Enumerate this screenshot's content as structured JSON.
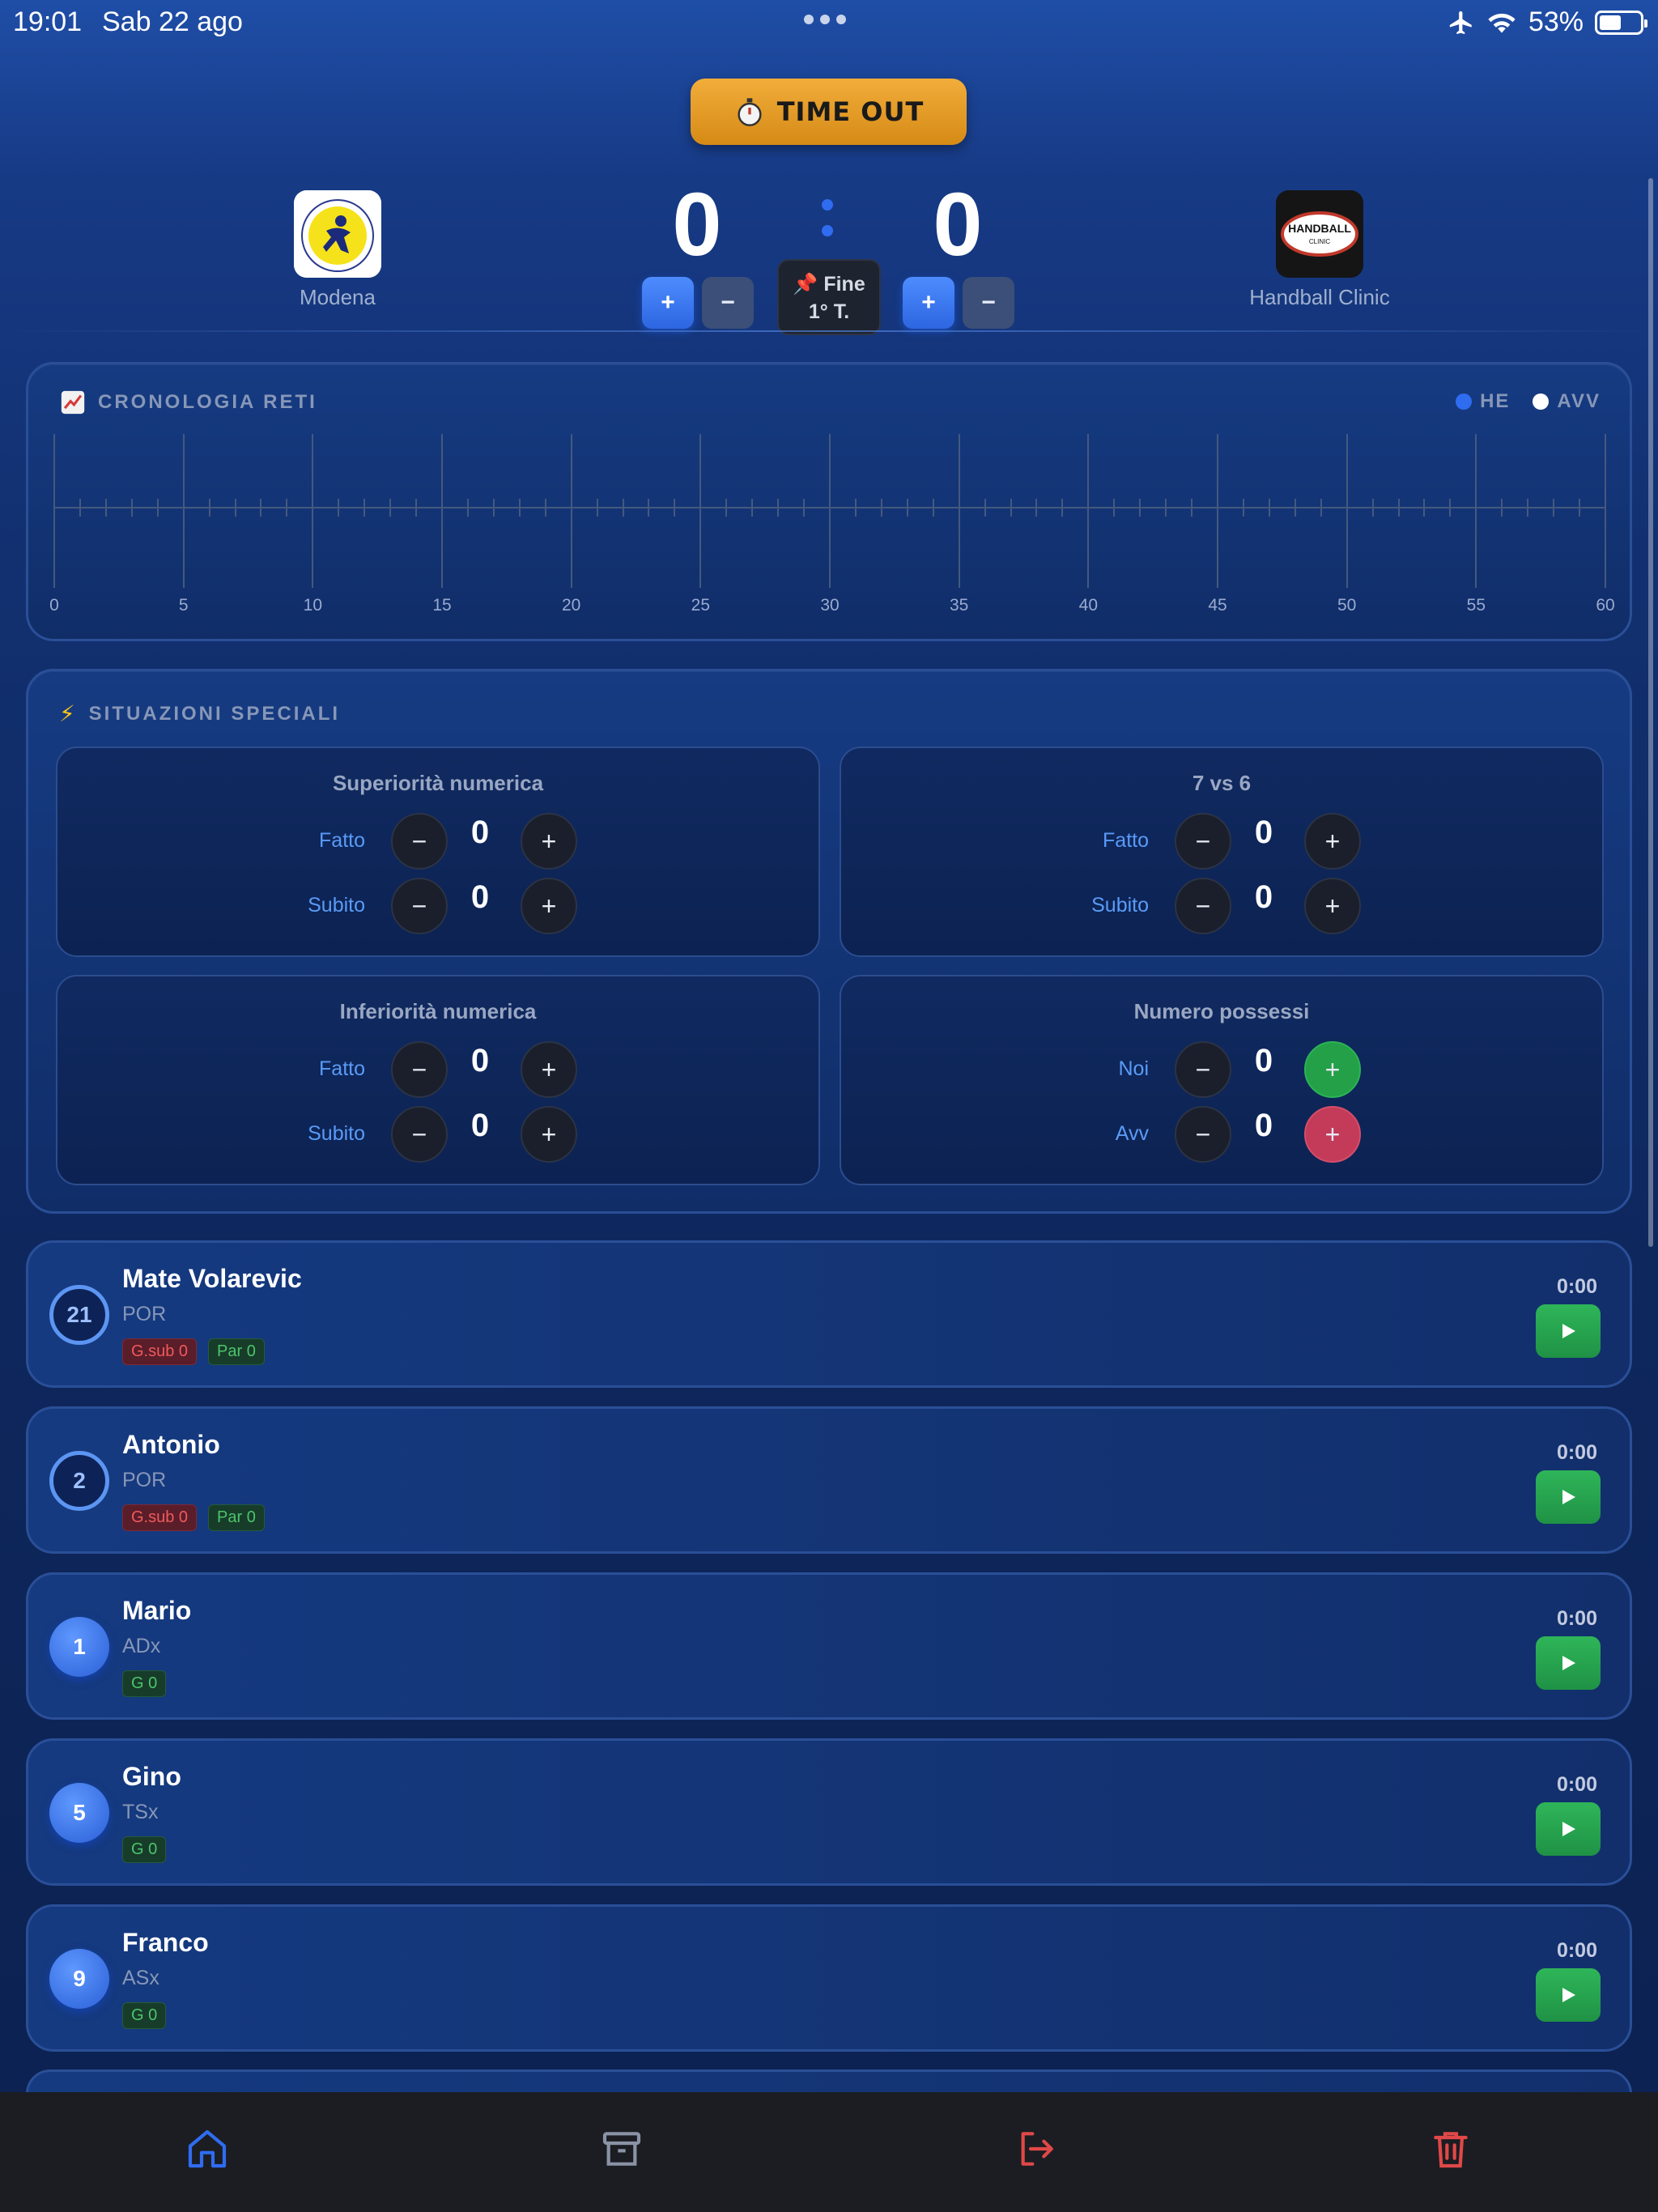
{
  "status_bar": {
    "time": "19:01",
    "date": "Sab 22 ago",
    "battery": "53%"
  },
  "timeout": {
    "icon": "stopwatch-icon",
    "label": "TIME OUT"
  },
  "scoreboard": {
    "home": {
      "name": "Modena",
      "score": "0"
    },
    "away": {
      "name": "Handball Clinic",
      "score": "0"
    },
    "period": {
      "line1": "Fine",
      "line2": "1° T."
    },
    "plus": "+",
    "minus": "−"
  },
  "timeline": {
    "title": "CRONOLOGIA RETI",
    "legend_home": "HE",
    "legend_away": "AVV",
    "ticks": [
      "0",
      "5",
      "10",
      "15",
      "20",
      "25",
      "30",
      "35",
      "40",
      "45",
      "50",
      "55",
      "60"
    ],
    "colors": {
      "home": "#2f6cf0",
      "away": "#ffffff"
    }
  },
  "special": {
    "title": "SITUAZIONI SPECIALI",
    "boxes": [
      {
        "title": "Superiorità numerica",
        "rows": [
          {
            "label": "Fatto",
            "value": "0"
          },
          {
            "label": "Subito",
            "value": "0"
          }
        ]
      },
      {
        "title": "7 vs 6",
        "rows": [
          {
            "label": "Fatto",
            "value": "0"
          },
          {
            "label": "Subito",
            "value": "0"
          }
        ]
      },
      {
        "title": "Inferiorità numerica",
        "rows": [
          {
            "label": "Fatto",
            "value": "0"
          },
          {
            "label": "Subito",
            "value": "0"
          }
        ]
      },
      {
        "title": "Numero possessi",
        "rows": [
          {
            "label": "Noi",
            "value": "0"
          },
          {
            "label": "Avv",
            "value": "0"
          }
        ]
      }
    ],
    "minus": "−",
    "plus": "+"
  },
  "players": [
    {
      "number": "21",
      "name": "Mate Volarevic",
      "role": "POR",
      "badges": [
        "G.sub 0",
        "Par 0"
      ],
      "time": "0:00"
    },
    {
      "number": "2",
      "name": "Antonio",
      "role": "POR",
      "badges": [
        "G.sub 0",
        "Par 0"
      ],
      "time": "0:00"
    },
    {
      "number": "1",
      "name": "Mario",
      "role": "ADx",
      "badges": [
        "G 0"
      ],
      "time": "0:00"
    },
    {
      "number": "5",
      "name": "Gino",
      "role": "TSx",
      "badges": [
        "G 0"
      ],
      "time": "0:00"
    },
    {
      "number": "9",
      "name": "Franco",
      "role": "ASx",
      "badges": [
        "G 0"
      ],
      "time": "0:00"
    }
  ],
  "logos": {
    "away_text_1": "HANDBALL",
    "away_text_2": "CLINIC"
  },
  "bottom_nav": [
    {
      "icon": "home-icon",
      "color": "#2f6cf0"
    },
    {
      "icon": "archive-icon",
      "color": "#8a93a6"
    },
    {
      "icon": "logout-icon",
      "color": "#e04848"
    },
    {
      "icon": "trash-icon",
      "color": "#e04848"
    }
  ]
}
